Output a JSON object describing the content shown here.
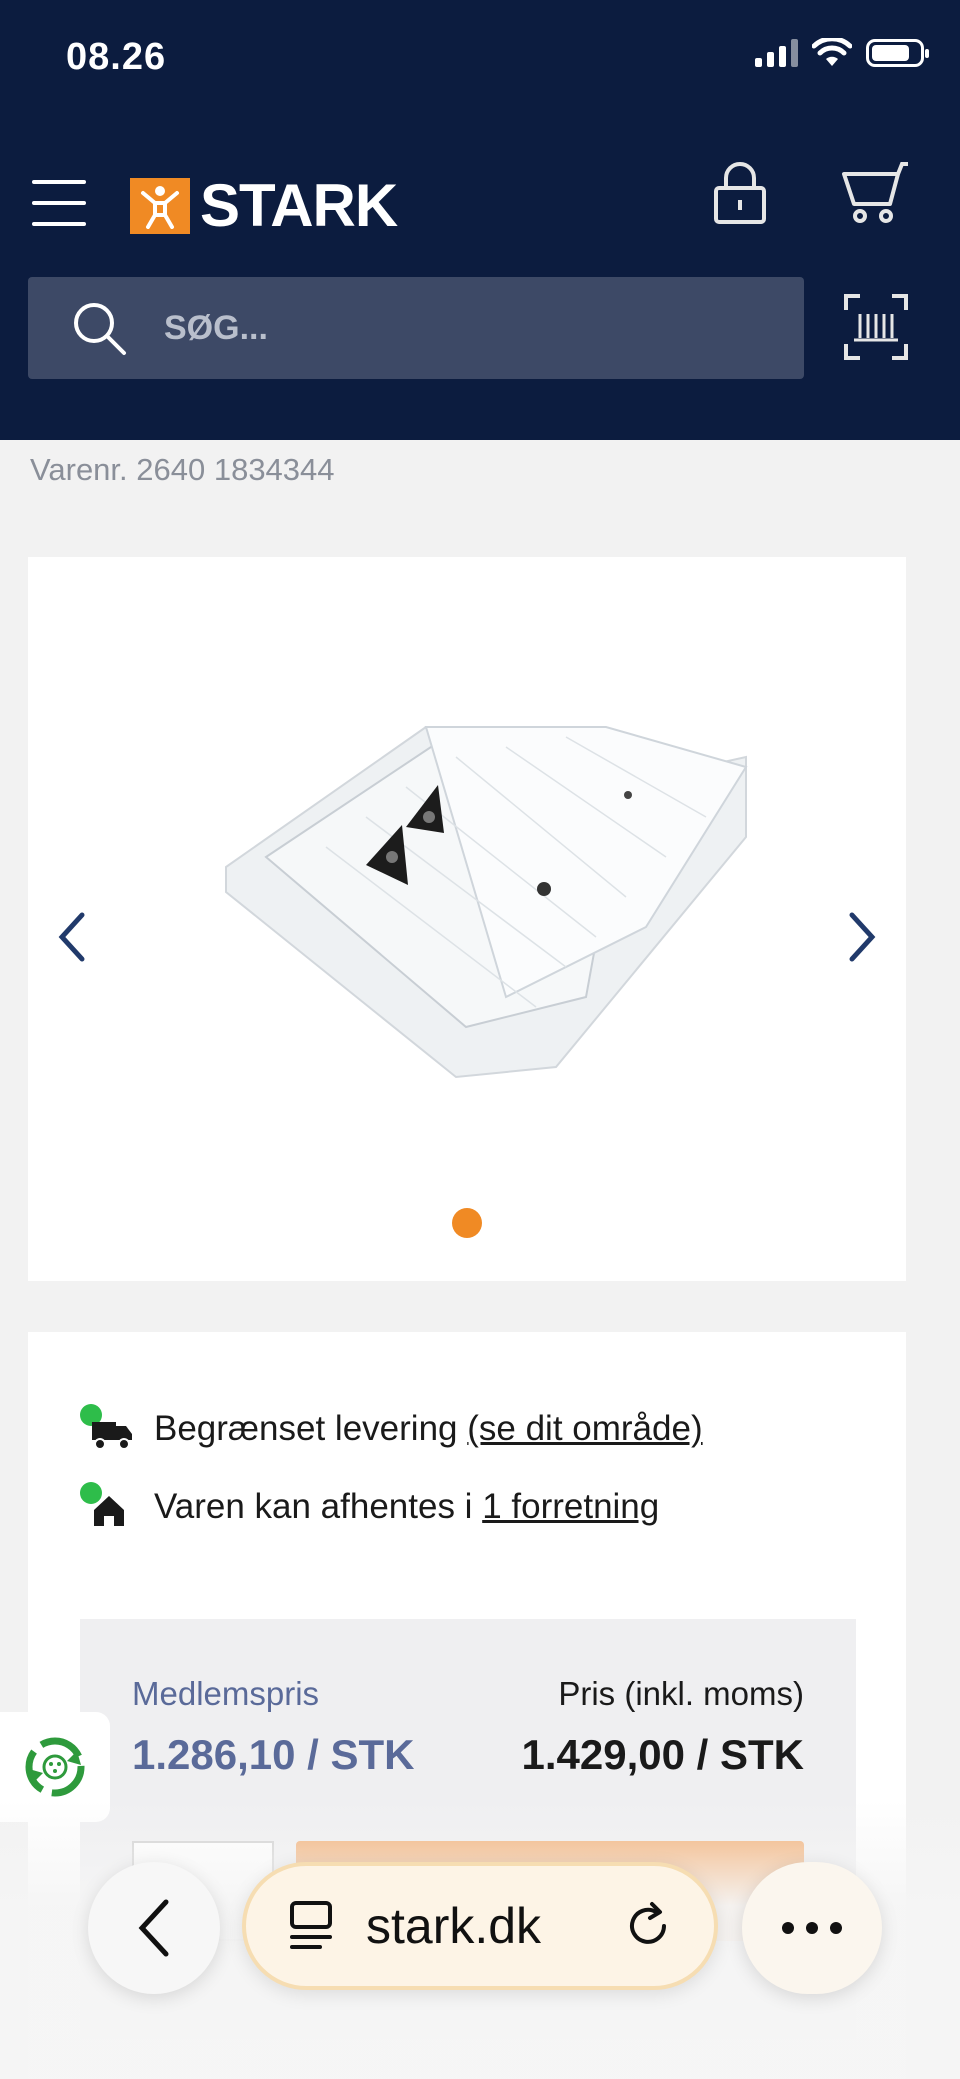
{
  "status_bar": {
    "time": "08.26"
  },
  "header": {
    "logo_text": "STARK",
    "search_placeholder": "SØG..."
  },
  "product": {
    "sku_label": "Varenr. 2640 1834344",
    "gallery": {
      "slide_count": 1,
      "active_slide": 1
    }
  },
  "availability": [
    {
      "text": "Begrænset levering ",
      "link": "(se dit område)",
      "icon": "delivery-truck-icon",
      "status_color": "#2ebd4a"
    },
    {
      "text": "Varen kan afhentes i ",
      "link": "1 forretning",
      "icon": "store-house-icon",
      "status_color": "#2ebd4a"
    }
  ],
  "pricing": {
    "member_label": "Medlemspris",
    "member_price": "1.286,10 / STK",
    "price_label": "Pris (inkl. moms)",
    "price_value": "1.429,00 / STK"
  },
  "browser_bar": {
    "url": "stark.dk"
  },
  "colors": {
    "navy": "#0c1c3f",
    "brand_orange": "#f08a24",
    "member_blue": "#5a6a99"
  }
}
